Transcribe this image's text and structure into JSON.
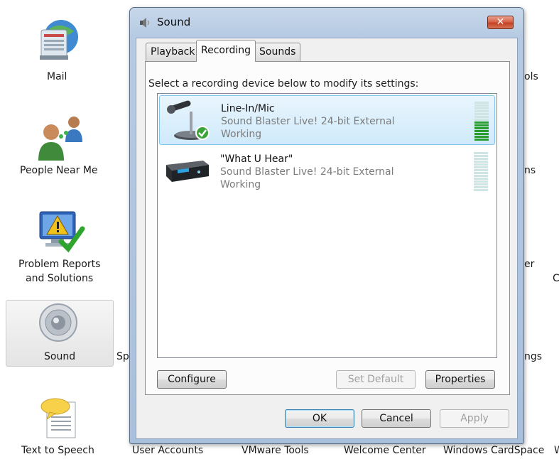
{
  "control_panel": {
    "items": [
      {
        "label": "Mail",
        "icon": "mail-icon"
      },
      {
        "label": "People Near Me",
        "icon": "people-icon"
      },
      {
        "label_line1": "Problem Reports",
        "label_line2": "and Solutions",
        "icon": "problem-reports-icon"
      },
      {
        "label": "Sound",
        "icon": "speaker-icon",
        "selected": true
      },
      {
        "label": "Text to Speech",
        "icon": "speech-bubble-icon"
      }
    ],
    "bottom_row": [
      "User Accounts",
      "VMware Tools",
      "Welcome Center",
      "Windows CardSpace",
      "W"
    ],
    "partial_right": [
      "ols",
      "ns",
      "er",
      "C",
      "ngs"
    ],
    "partial_sound_neighbor": "Sp"
  },
  "dialog": {
    "title": "Sound",
    "close_label": "✕",
    "tabs": [
      {
        "label": "Playback",
        "active": false
      },
      {
        "label": "Recording",
        "active": true
      },
      {
        "label": "Sounds",
        "active": false
      }
    ],
    "instruction": "Select a recording device below to modify its settings:",
    "devices": [
      {
        "name": "Line-In/Mic",
        "description": "Sound Blaster Live! 24-bit External",
        "status": "Working",
        "selected": true,
        "is_default": true,
        "icon": "microphone-icon",
        "level_bars_total": 14,
        "level_bars_on": 7
      },
      {
        "name": "\"What U Hear\"",
        "description": "Sound Blaster Live! 24-bit External",
        "status": "Working",
        "selected": false,
        "is_default": false,
        "icon": "sound-device-icon",
        "level_bars_total": 14,
        "level_bars_on": 0
      }
    ],
    "buttons": {
      "configure": "Configure",
      "set_default": "Set Default",
      "properties": "Properties",
      "ok": "OK",
      "cancel": "Cancel",
      "apply": "Apply"
    }
  },
  "colors": {
    "meter_on": "#2b9d2f",
    "meter_off": "#cfe5e3",
    "selection": "#cfeafb",
    "close_button": "#c33f23"
  }
}
